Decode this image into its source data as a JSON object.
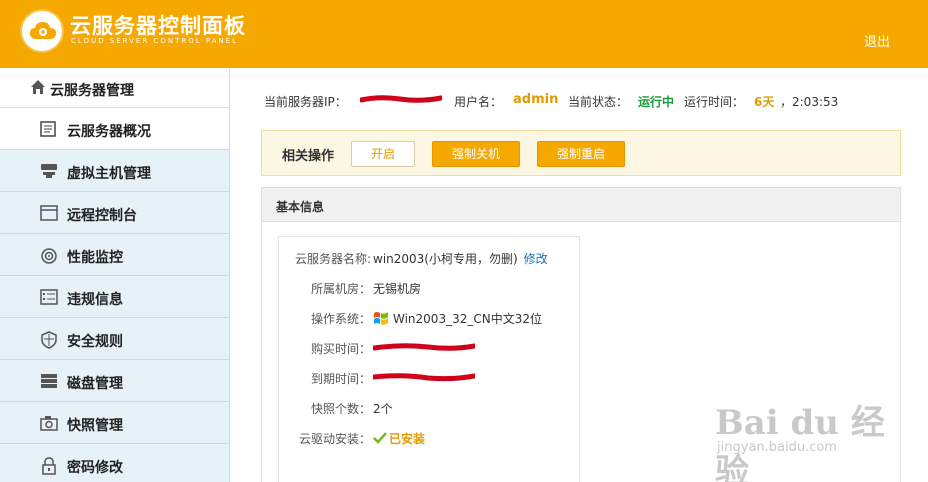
{
  "header": {
    "title": "云服务器控制面板",
    "subtitle": "CLOUD SERVER CONTROL PANEL",
    "logout_label": "退出",
    "accent": "#f5a800"
  },
  "sidebar": {
    "section_title": "云服务器管理",
    "section_icon": "home-icon",
    "items": [
      {
        "label": "云服务器概况",
        "icon": "overview-icon",
        "active": true
      },
      {
        "label": "虚拟主机管理",
        "icon": "server-icon",
        "active": false
      },
      {
        "label": "远程控制台",
        "icon": "console-icon",
        "active": false
      },
      {
        "label": "性能监控",
        "icon": "monitor-icon",
        "active": false
      },
      {
        "label": "违规信息",
        "icon": "list-icon",
        "active": false
      },
      {
        "label": "安全规则",
        "icon": "shield-icon",
        "active": false
      },
      {
        "label": "磁盘管理",
        "icon": "disk-icon",
        "active": false
      },
      {
        "label": "快照管理",
        "icon": "camera-icon",
        "active": false
      },
      {
        "label": "密码修改",
        "icon": "lock-icon",
        "active": false
      }
    ]
  },
  "status": {
    "ip_label": "当前服务器IP：",
    "username_label": "用户名：",
    "username": "admin",
    "state_label": "当前状态：",
    "state": "运行中",
    "uptime_label": "运行时间：",
    "uptime_days": "6天",
    "uptime_time": "，2:03:53"
  },
  "operations": {
    "label": "相关操作",
    "start": "开启",
    "force_off": "强制关机",
    "force_reboot": "强制重启"
  },
  "basic_info": {
    "title": "基本信息",
    "name_label": "云服务器名称:",
    "name_value": "win2003(小柯专用，勿删)",
    "edit_label": "修改",
    "room_label": "所属机房：",
    "room_value": "无锡机房",
    "os_label": "操作系统：",
    "os_value": "Win2003_32_CN中文32位",
    "os_icon": "windows-icon",
    "buy_label": "购买时间：",
    "expire_label": "到期时间：",
    "snap_label": "快照个数：",
    "snap_value": "2个",
    "driver_label": "云驱动安装：",
    "driver_value": "已安装",
    "check_icon": "check-icon"
  },
  "watermark": {
    "main": "Bai du 经验",
    "sub": "jingyan.baidu.com"
  },
  "colors": {
    "redaction": "#d0021b",
    "status_green": "#1a9b3b",
    "link_blue": "#1a6fb5"
  }
}
